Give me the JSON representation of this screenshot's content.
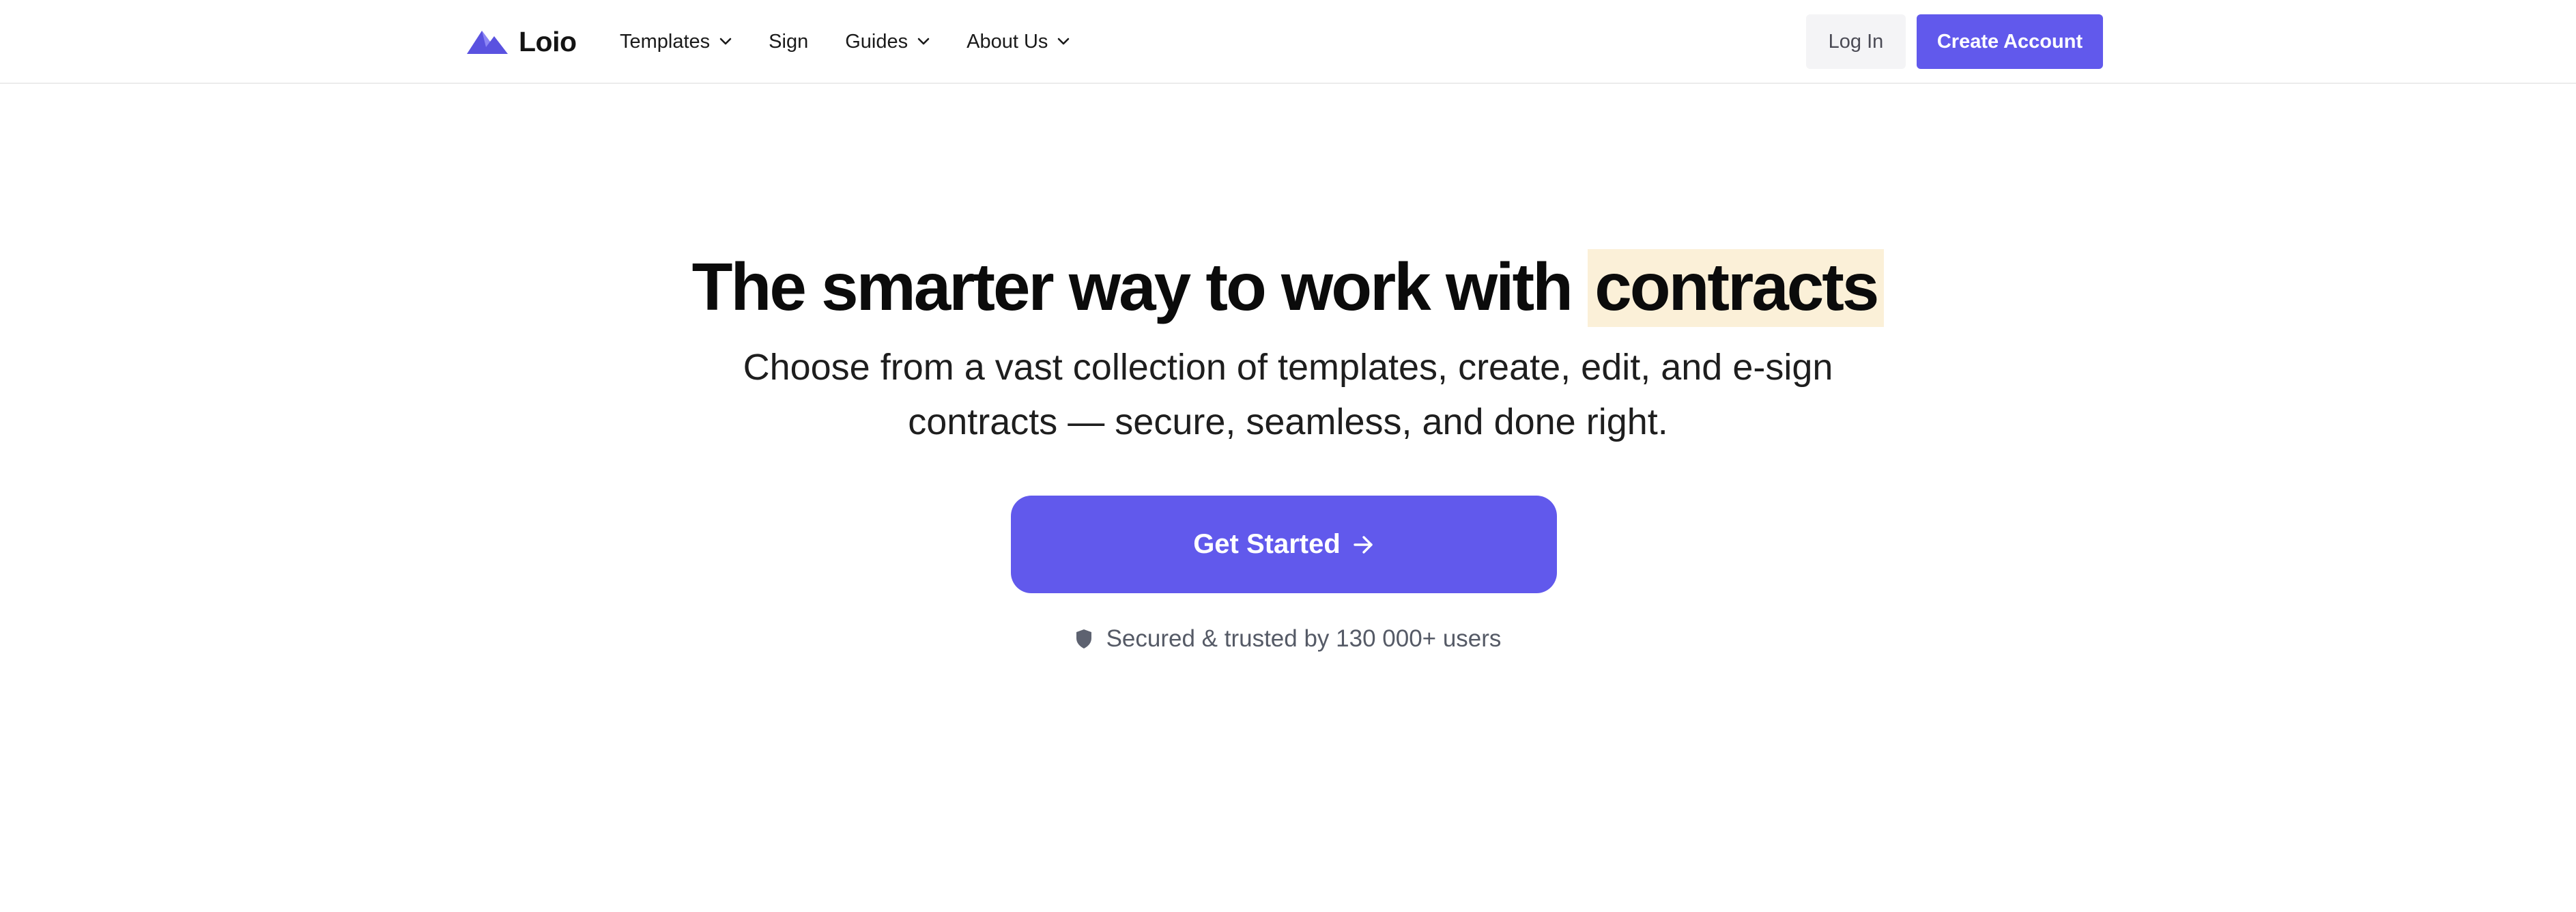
{
  "brand": {
    "name": "Loio",
    "logo_icon": "mountain-logo-icon",
    "accent": "#6159ec"
  },
  "nav": {
    "items": [
      {
        "label": "Templates",
        "has_dropdown": true
      },
      {
        "label": "Sign",
        "has_dropdown": false
      },
      {
        "label": "Guides",
        "has_dropdown": true
      },
      {
        "label": "About Us",
        "has_dropdown": true
      }
    ]
  },
  "header": {
    "login_label": "Log In",
    "create_label": "Create Account"
  },
  "hero": {
    "title_main": "The smarter way to work with",
    "title_highlight": "contracts",
    "highlight_color": "#fbf0d8",
    "subtitle_line1": "Choose from a vast collection of templates, create, edit, and e-sign",
    "subtitle_line2": "contracts — secure, seamless, and done right.",
    "cta_label": "Get Started",
    "cta_icon": "arrow-right-icon",
    "trust_text": "Secured & trusted by 130 000+ users",
    "trust_icon": "shield-icon"
  }
}
